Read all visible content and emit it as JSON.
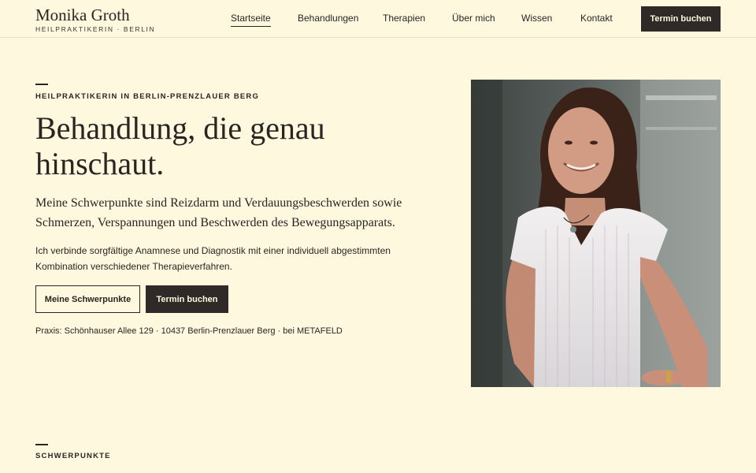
{
  "brand": {
    "name": "Monika Groth",
    "subtitle": "HEILPRAKTIKERIN · BERLIN"
  },
  "nav": {
    "items": [
      {
        "label": "Startseite",
        "active": true
      },
      {
        "label": "Behandlungen",
        "active": false
      },
      {
        "label": "Therapien",
        "active": false
      },
      {
        "label": "Über mich",
        "active": false
      },
      {
        "label": "Wissen",
        "active": false
      },
      {
        "label": "Kontakt",
        "active": false
      }
    ],
    "cta_label": "Termin buchen"
  },
  "hero": {
    "eyebrow": "HEILPRAKTIKERIN IN BERLIN-PRENZLAUER BERG",
    "title": "Behandlung, die genau hinschaut.",
    "lead": "Meine Schwerpunkte sind Reizdarm und Verdauungsbeschwerden sowie Schmerzen, Verspannungen und Beschwerden des Bewegungsapparats.",
    "body": "Ich verbinde sorgfältige Anamnese und Diagnostik mit einer individuell abgestimmten Kombination verschiedener Therapieverfahren.",
    "primary_button": "Meine Schwerpunkte",
    "secondary_button": "Termin buchen",
    "address": "Praxis: Schönhauser Allee 129 · 10437 Berlin-Prenzlauer Berg · bei METAFELD",
    "image_alt": "portrait-photo"
  },
  "section": {
    "eyebrow": "SCHWERPUNKTE"
  },
  "colors": {
    "background": "#fdf8de",
    "text": "#2a2523",
    "dark_button": "#2f2a27"
  }
}
